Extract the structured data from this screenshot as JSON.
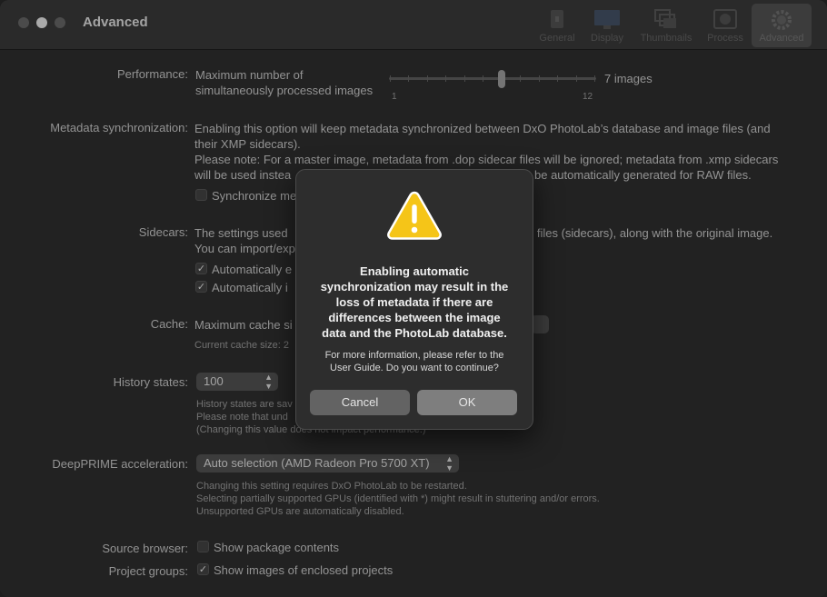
{
  "window": {
    "title": "Advanced",
    "toolbar": [
      {
        "label": "General",
        "icon": "general-icon"
      },
      {
        "label": "Display",
        "icon": "display-icon"
      },
      {
        "label": "Thumbnails",
        "icon": "thumbnails-icon"
      },
      {
        "label": "Process",
        "icon": "process-icon"
      },
      {
        "label": "Advanced",
        "icon": "gear-icon",
        "active": true
      }
    ]
  },
  "performance": {
    "label": "Performance:",
    "desc_line1": "Maximum number of",
    "desc_line2": "simultaneously processed images",
    "value": "7 images",
    "min": "1",
    "max": "12",
    "current": 7
  },
  "metadata_sync": {
    "label": "Metadata synchronization:",
    "line1": "Enabling this option will keep metadata synchronized between DxO PhotoLab’s database and image files (and",
    "line2": "their XMP sidecars).",
    "line3": "Please note: For a master image, metadata from .dop sidecar files will be ignored; metadata from .xmp sidecars",
    "line4_left": "will be used instea",
    "line4_right": "be automatically generated for RAW files.",
    "checkbox_label": "Synchronize me",
    "checked": false
  },
  "sidecars": {
    "label": "Sidecars:",
    "line1_left": "The settings used",
    "line1_right": "e files (sidecars), along with the original image.",
    "line2": "You can import/exp",
    "cb1_label": "Automatically e",
    "cb2_label": "Automatically i",
    "cb1_checked": true,
    "cb2_checked": true
  },
  "cache": {
    "label": "Cache:",
    "desc": "Maximum cache si",
    "current": "Current cache size: 2"
  },
  "history": {
    "label": "History states:",
    "value": "100",
    "note1": "History states are sav",
    "note2": "Please note that und",
    "note3": "(Changing this value does not impact performance.)"
  },
  "deepprime": {
    "label": "DeepPRIME acceleration:",
    "value": "Auto selection (AMD Radeon Pro 5700 XT)",
    "note1": "Changing this setting requires DxO PhotoLab to be restarted.",
    "note2": "Selecting partially supported GPUs (identified with *) might result in stuttering and/or errors.",
    "note3": "Unsupported GPUs are automatically disabled."
  },
  "source_browser": {
    "label": "Source browser:",
    "checkbox_label": "Show package contents",
    "checked": false
  },
  "project_groups": {
    "label": "Project groups:",
    "checkbox_label": "Show images of enclosed projects",
    "checked": true
  },
  "dialog": {
    "icon": "warning-icon",
    "title": "Enabling automatic\nsynchronization may result in the\nloss of metadata if there are\ndifferences between the image\ndata and the PhotoLab database.",
    "message": "For more information, please refer to the\nUser Guide. Do you want to continue?",
    "cancel": "Cancel",
    "ok": "OK"
  },
  "colors": {
    "warning_yellow": "#f5c518",
    "background": "#2a2a2a"
  }
}
